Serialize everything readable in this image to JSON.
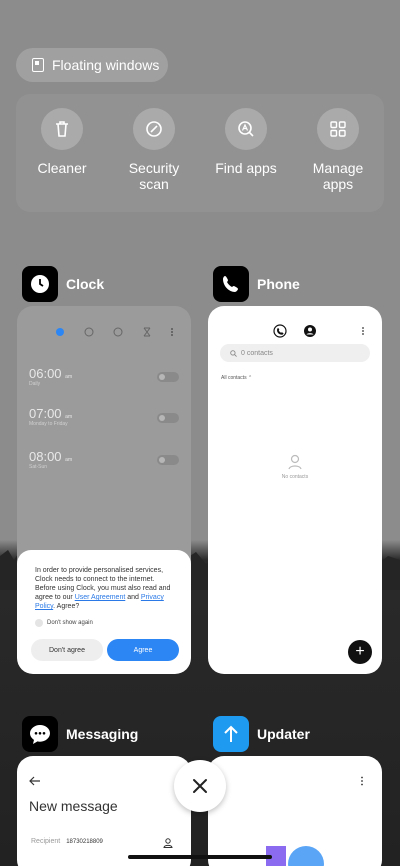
{
  "floating_windows": {
    "label": "Floating windows"
  },
  "tools": [
    {
      "label": "Cleaner",
      "icon": "trash-icon"
    },
    {
      "label": "Security scan",
      "icon": "shield-scan-icon"
    },
    {
      "label": "Find apps",
      "icon": "search-app-icon"
    },
    {
      "label": "Manage apps",
      "icon": "grid-icon"
    }
  ],
  "apps": {
    "clock": {
      "name": "Clock"
    },
    "phone": {
      "name": "Phone"
    },
    "messaging": {
      "name": "Messaging"
    },
    "updater": {
      "name": "Updater"
    }
  },
  "clock_preview": {
    "alarms": [
      {
        "time": "06:00",
        "ampm": "am",
        "sub": "Daily"
      },
      {
        "time": "07:00",
        "ampm": "am",
        "sub": "Monday to Friday"
      },
      {
        "time": "08:00",
        "ampm": "am",
        "sub": "Sat-Sun"
      }
    ],
    "dialog": {
      "message_1": "In order to provide personalised services, Clock needs to connect to the internet. Before using Clock, you must also read and agree to our ",
      "link_1": "User Agreement",
      "message_2": " and ",
      "link_2": "Privacy Policy",
      "message_3": ". Agree?",
      "checkbox": "Don't show again",
      "decline": "Don't agree",
      "accept": "Agree"
    }
  },
  "phone_preview": {
    "search_placeholder": "0 contacts",
    "filter": "All contacts",
    "empty": "No contacts"
  },
  "messaging_preview": {
    "title": "New message",
    "recipient_label": "Recipient",
    "recipient_value": "18730218809"
  },
  "colors": {
    "accent": "#2c86f4",
    "link": "#2a79e6"
  }
}
